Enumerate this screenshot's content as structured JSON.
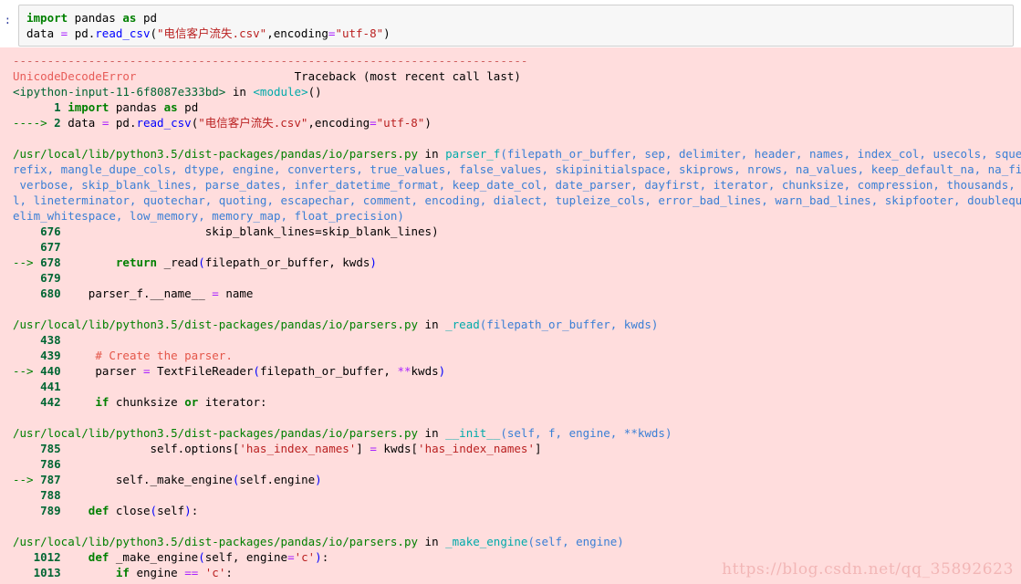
{
  "input_cell": {
    "prompt": ":",
    "lines": [
      [
        {
          "t": "import",
          "c": "k"
        },
        {
          "t": " pandas ",
          "c": "plain"
        },
        {
          "t": "as",
          "c": "k"
        },
        {
          "t": " pd",
          "c": "plain"
        }
      ],
      [
        {
          "t": "data ",
          "c": "plain"
        },
        {
          "t": "=",
          "c": "op"
        },
        {
          "t": " pd.",
          "c": "plain"
        },
        {
          "t": "read_csv",
          "c": "fn"
        },
        {
          "t": "(",
          "c": "plain"
        },
        {
          "t": "\"电信客户流失.csv\"",
          "c": "str"
        },
        {
          "t": ",encoding",
          "c": "plain"
        },
        {
          "t": "=",
          "c": "op"
        },
        {
          "t": "\"utf-8\"",
          "c": "str"
        },
        {
          "t": ")",
          "c": "plain"
        }
      ]
    ]
  },
  "error_output": {
    "separator": "---------------------------------------------------------------------------",
    "lines": [
      {
        "id": "sep",
        "spans": [
          {
            "t": "---------------------------------------------------------------------------",
            "c": "dashes"
          }
        ]
      },
      {
        "id": "error-header",
        "spans": [
          {
            "t": "UnicodeDecodeError",
            "c": "errname"
          },
          {
            "t": "                       ",
            "c": "plain"
          },
          {
            "t": "Traceback (most recent call last)",
            "c": "plain"
          }
        ]
      },
      {
        "id": "frame-ipython",
        "spans": [
          {
            "t": "<ipython-input-11-6f8087e333bd>",
            "c": "green"
          },
          {
            "t": " in ",
            "c": "plain"
          },
          {
            "t": "<module>",
            "c": "cyan"
          },
          {
            "t": "()",
            "c": "plain"
          }
        ]
      },
      {
        "id": "src-1",
        "spans": [
          {
            "t": "      ",
            "c": "plain"
          },
          {
            "t": "1",
            "c": "lineno"
          },
          {
            "t": " ",
            "c": "plain"
          },
          {
            "t": "import",
            "c": "k"
          },
          {
            "t": " pandas ",
            "c": "plain"
          },
          {
            "t": "as",
            "c": "k"
          },
          {
            "t": " pd",
            "c": "plain"
          }
        ]
      },
      {
        "id": "src-2-current",
        "spans": [
          {
            "t": "----> ",
            "c": "arrow"
          },
          {
            "t": "2",
            "c": "lineno"
          },
          {
            "t": " data ",
            "c": "plain"
          },
          {
            "t": "=",
            "c": "op"
          },
          {
            "t": " pd.",
            "c": "plain"
          },
          {
            "t": "read_csv",
            "c": "fn"
          },
          {
            "t": "(",
            "c": "plain"
          },
          {
            "t": "\"电信客户流失.csv\"",
            "c": "str"
          },
          {
            "t": ",encoding",
            "c": "plain"
          },
          {
            "t": "=",
            "c": "op"
          },
          {
            "t": "\"utf-8\"",
            "c": "str"
          },
          {
            "t": ")",
            "c": "plain"
          }
        ]
      },
      {
        "id": "blank-1",
        "spans": []
      },
      {
        "id": "frame-parser-f",
        "spans": [
          {
            "t": "/usr/local/lib/python3.5/dist-packages/pandas/io/parsers.py",
            "c": "pathsig"
          },
          {
            "t": " in ",
            "c": "plain"
          },
          {
            "t": "parser_f",
            "c": "funcname"
          },
          {
            "t": "(filepath_or_buffer, sep, delimiter, header, names, index_col, usecols, squeeze, p",
            "c": "param"
          }
        ]
      },
      {
        "id": "frame-parser-f-cont1",
        "spans": [
          {
            "t": "refix, mangle_dupe_cols, dtype, engine, converters, true_values, false_values, skipinitialspace, skiprows, nrows, na_values, keep_default_na, na_filter,",
            "c": "param"
          }
        ]
      },
      {
        "id": "frame-parser-f-cont2",
        "spans": [
          {
            "t": " verbose, skip_blank_lines, parse_dates, infer_datetime_format, keep_date_col, date_parser, dayfirst, iterator, chunksize, compression, thousands, decima",
            "c": "param"
          }
        ]
      },
      {
        "id": "frame-parser-f-cont3",
        "spans": [
          {
            "t": "l, lineterminator, quotechar, quoting, escapechar, comment, encoding, dialect, tupleize_cols, error_bad_lines, warn_bad_lines, skipfooter, doublequote, d",
            "c": "param"
          }
        ]
      },
      {
        "id": "frame-parser-f-cont4",
        "spans": [
          {
            "t": "elim_whitespace, low_memory, memory_map, float_precision)",
            "c": "param"
          }
        ]
      },
      {
        "id": "src-676",
        "spans": [
          {
            "t": "    ",
            "c": "plain"
          },
          {
            "t": "676",
            "c": "lineno"
          },
          {
            "t": "                     skip_blank_lines=skip_blank_lines)",
            "c": "plain"
          }
        ]
      },
      {
        "id": "src-677",
        "spans": [
          {
            "t": "    ",
            "c": "plain"
          },
          {
            "t": "677",
            "c": "lineno"
          }
        ]
      },
      {
        "id": "src-678-current",
        "spans": [
          {
            "t": "--> ",
            "c": "arrow"
          },
          {
            "t": "678",
            "c": "lineno"
          },
          {
            "t": "        ",
            "c": "plain"
          },
          {
            "t": "return",
            "c": "k"
          },
          {
            "t": " _read",
            "c": "plain"
          },
          {
            "t": "(",
            "c": "fn"
          },
          {
            "t": "filepath_or_buffer, kwds",
            "c": "plain"
          },
          {
            "t": ")",
            "c": "fn"
          }
        ]
      },
      {
        "id": "src-679",
        "spans": [
          {
            "t": "    ",
            "c": "plain"
          },
          {
            "t": "679",
            "c": "lineno"
          }
        ]
      },
      {
        "id": "src-680",
        "spans": [
          {
            "t": "    ",
            "c": "plain"
          },
          {
            "t": "680",
            "c": "lineno"
          },
          {
            "t": "    parser_f.",
            "c": "plain"
          },
          {
            "t": "__name__",
            "c": "plain"
          },
          {
            "t": " ",
            "c": "plain"
          },
          {
            "t": "=",
            "c": "op"
          },
          {
            "t": " name",
            "c": "plain"
          }
        ]
      },
      {
        "id": "blank-2",
        "spans": []
      },
      {
        "id": "frame-_read",
        "spans": [
          {
            "t": "/usr/local/lib/python3.5/dist-packages/pandas/io/parsers.py",
            "c": "pathsig"
          },
          {
            "t": " in ",
            "c": "plain"
          },
          {
            "t": "_read",
            "c": "funcname"
          },
          {
            "t": "(filepath_or_buffer, kwds)",
            "c": "param"
          }
        ]
      },
      {
        "id": "src-438",
        "spans": [
          {
            "t": "    ",
            "c": "plain"
          },
          {
            "t": "438",
            "c": "lineno"
          }
        ]
      },
      {
        "id": "src-439",
        "spans": [
          {
            "t": "    ",
            "c": "plain"
          },
          {
            "t": "439",
            "c": "lineno"
          },
          {
            "t": "     ",
            "c": "plain"
          },
          {
            "t": "# Create the parser.",
            "c": "comment"
          }
        ]
      },
      {
        "id": "src-440-current",
        "spans": [
          {
            "t": "--> ",
            "c": "arrow"
          },
          {
            "t": "440",
            "c": "lineno"
          },
          {
            "t": "     parser ",
            "c": "plain"
          },
          {
            "t": "=",
            "c": "op"
          },
          {
            "t": " TextFileReader",
            "c": "plain"
          },
          {
            "t": "(",
            "c": "fn"
          },
          {
            "t": "filepath_or_buffer, ",
            "c": "plain"
          },
          {
            "t": "**",
            "c": "op"
          },
          {
            "t": "kwds",
            "c": "plain"
          },
          {
            "t": ")",
            "c": "fn"
          }
        ]
      },
      {
        "id": "src-441",
        "spans": [
          {
            "t": "    ",
            "c": "plain"
          },
          {
            "t": "441",
            "c": "lineno"
          }
        ]
      },
      {
        "id": "src-442",
        "spans": [
          {
            "t": "    ",
            "c": "plain"
          },
          {
            "t": "442",
            "c": "lineno"
          },
          {
            "t": "     ",
            "c": "plain"
          },
          {
            "t": "if",
            "c": "k"
          },
          {
            "t": " chunksize ",
            "c": "plain"
          },
          {
            "t": "or",
            "c": "k"
          },
          {
            "t": " iterator:",
            "c": "plain"
          }
        ]
      },
      {
        "id": "blank-3",
        "spans": []
      },
      {
        "id": "frame-init",
        "spans": [
          {
            "t": "/usr/local/lib/python3.5/dist-packages/pandas/io/parsers.py",
            "c": "pathsig"
          },
          {
            "t": " in ",
            "c": "plain"
          },
          {
            "t": "__init__",
            "c": "funcname"
          },
          {
            "t": "(self, f, engine, **kwds)",
            "c": "param"
          }
        ]
      },
      {
        "id": "src-785",
        "spans": [
          {
            "t": "    ",
            "c": "plain"
          },
          {
            "t": "785",
            "c": "lineno"
          },
          {
            "t": "             self.options[",
            "c": "plain"
          },
          {
            "t": "'has_index_names'",
            "c": "str"
          },
          {
            "t": "] ",
            "c": "plain"
          },
          {
            "t": "=",
            "c": "op"
          },
          {
            "t": " kwds[",
            "c": "plain"
          },
          {
            "t": "'has_index_names'",
            "c": "str"
          },
          {
            "t": "]",
            "c": "plain"
          }
        ]
      },
      {
        "id": "src-786",
        "spans": [
          {
            "t": "    ",
            "c": "plain"
          },
          {
            "t": "786",
            "c": "lineno"
          }
        ]
      },
      {
        "id": "src-787-current",
        "spans": [
          {
            "t": "--> ",
            "c": "arrow"
          },
          {
            "t": "787",
            "c": "lineno"
          },
          {
            "t": "        self._make_engine",
            "c": "plain"
          },
          {
            "t": "(",
            "c": "fn"
          },
          {
            "t": "self.engine",
            "c": "plain"
          },
          {
            "t": ")",
            "c": "fn"
          }
        ]
      },
      {
        "id": "src-788",
        "spans": [
          {
            "t": "    ",
            "c": "plain"
          },
          {
            "t": "788",
            "c": "lineno"
          }
        ]
      },
      {
        "id": "src-789",
        "spans": [
          {
            "t": "    ",
            "c": "plain"
          },
          {
            "t": "789",
            "c": "lineno"
          },
          {
            "t": "    ",
            "c": "plain"
          },
          {
            "t": "def",
            "c": "k"
          },
          {
            "t": " close",
            "c": "plain"
          },
          {
            "t": "(",
            "c": "fn"
          },
          {
            "t": "self",
            "c": "plain"
          },
          {
            "t": ")",
            "c": "fn"
          },
          {
            "t": ":",
            "c": "plain"
          }
        ]
      },
      {
        "id": "blank-4",
        "spans": []
      },
      {
        "id": "frame-make-engine",
        "spans": [
          {
            "t": "/usr/local/lib/python3.5/dist-packages/pandas/io/parsers.py",
            "c": "pathsig"
          },
          {
            "t": " in ",
            "c": "plain"
          },
          {
            "t": "_make_engine",
            "c": "funcname"
          },
          {
            "t": "(self, engine)",
            "c": "param"
          }
        ]
      },
      {
        "id": "src-1012",
        "spans": [
          {
            "t": "   ",
            "c": "plain"
          },
          {
            "t": "1012",
            "c": "lineno"
          },
          {
            "t": "    ",
            "c": "plain"
          },
          {
            "t": "def",
            "c": "k"
          },
          {
            "t": " _make_engine",
            "c": "plain"
          },
          {
            "t": "(",
            "c": "fn"
          },
          {
            "t": "self, engine",
            "c": "plain"
          },
          {
            "t": "=",
            "c": "op"
          },
          {
            "t": "'c'",
            "c": "str"
          },
          {
            "t": ")",
            "c": "fn"
          },
          {
            "t": ":",
            "c": "plain"
          }
        ]
      },
      {
        "id": "src-1013",
        "spans": [
          {
            "t": "   ",
            "c": "plain"
          },
          {
            "t": "1013",
            "c": "lineno"
          },
          {
            "t": "        ",
            "c": "plain"
          },
          {
            "t": "if",
            "c": "k"
          },
          {
            "t": " engine ",
            "c": "plain"
          },
          {
            "t": "==",
            "c": "op"
          },
          {
            "t": " ",
            "c": "plain"
          },
          {
            "t": "'c'",
            "c": "str"
          },
          {
            "t": ":",
            "c": "plain"
          }
        ]
      }
    ]
  },
  "watermark": {
    "text": "https://blog.csdn.net/qq_35892623"
  },
  "colors": {
    "error_background": "#ffdddd",
    "input_background": "#f7f7f7",
    "input_border": "#cfcfcf",
    "keyword": "#008000",
    "string": "#ba2121",
    "function": "#0000ff",
    "operator": "#aa22ff",
    "error_name": "#e75c58",
    "path": "#008000",
    "param": "#3a7fd5",
    "funcname": "#00aaaa",
    "lineno": "#006633",
    "comment": "#e45649",
    "watermark": "#f2b6b6"
  }
}
